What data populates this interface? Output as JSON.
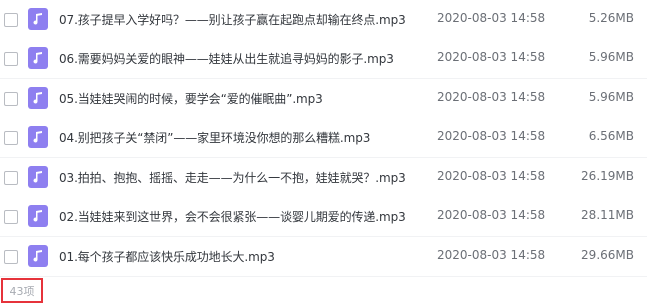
{
  "files": [
    {
      "name": "07.孩子提早入学好吗？——别让孩子赢在起跑点却输在终点.mp3",
      "date": "2020-08-03 14:58",
      "size": "5.26MB",
      "icon": "audio-file-icon"
    },
    {
      "name": "06.需要妈妈关爱的眼神——娃娃从出生就追寻妈妈的影子.mp3",
      "date": "2020-08-03 14:58",
      "size": "5.96MB",
      "icon": "audio-file-icon"
    },
    {
      "name": "05.当娃娃哭闹的时候，要学会“爱的催眠曲”.mp3",
      "date": "2020-08-03 14:58",
      "size": "5.96MB",
      "icon": "audio-file-icon"
    },
    {
      "name": "04.别把孩子关“禁闭”——家里环境没你想的那么糟糕.mp3",
      "date": "2020-08-03 14:58",
      "size": "6.56MB",
      "icon": "audio-file-icon"
    },
    {
      "name": "03.拍拍、抱抱、摇摇、走走——为什么一不抱，娃娃就哭？.mp3",
      "date": "2020-08-03 14:58",
      "size": "26.19MB",
      "icon": "audio-file-icon"
    },
    {
      "name": "02.当娃娃来到这世界，会不会很紧张——谈婴儿期爱的传递.mp3",
      "date": "2020-08-03 14:58",
      "size": "28.11MB",
      "icon": "audio-file-icon"
    },
    {
      "name": "01.每个孩子都应该快乐成功地长大.mp3",
      "date": "2020-08-03 14:58",
      "size": "29.66MB",
      "icon": "audio-file-icon"
    }
  ],
  "footer": {
    "count_label": "43项"
  },
  "colors": {
    "icon_bg": "#8e7ff0",
    "highlight_border": "#e6333b"
  }
}
